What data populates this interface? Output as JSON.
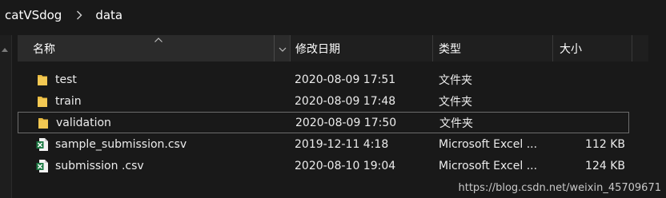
{
  "breadcrumb": {
    "items": [
      "catVSdog",
      "data"
    ]
  },
  "columns": {
    "name": "名称",
    "date": "修改日期",
    "type": "类型",
    "size": "大小"
  },
  "files": [
    {
      "name": "test",
      "date": "2020-08-09 17:51",
      "type": "文件夹",
      "size": "",
      "icon": "folder-icon"
    },
    {
      "name": "train",
      "date": "2020-08-09 17:48",
      "type": "文件夹",
      "size": "",
      "icon": "folder-icon"
    },
    {
      "name": "validation",
      "date": "2020-08-09 17:50",
      "type": "文件夹",
      "size": "",
      "icon": "folder-icon"
    },
    {
      "name": "sample_submission.csv",
      "date": "2019-12-11 4:18",
      "type": "Microsoft Excel ...",
      "size": "112 KB",
      "icon": "excel-csv-icon"
    },
    {
      "name": "submission .csv",
      "date": "2020-08-10 19:04",
      "type": "Microsoft Excel ...",
      "size": "124 KB",
      "icon": "excel-csv-icon"
    }
  ],
  "watermark": "https://blog.csdn.net/weixin_45709671",
  "colors": {
    "background": "#191919",
    "folder": "#e8b93e",
    "excel": "#1d7a44"
  }
}
